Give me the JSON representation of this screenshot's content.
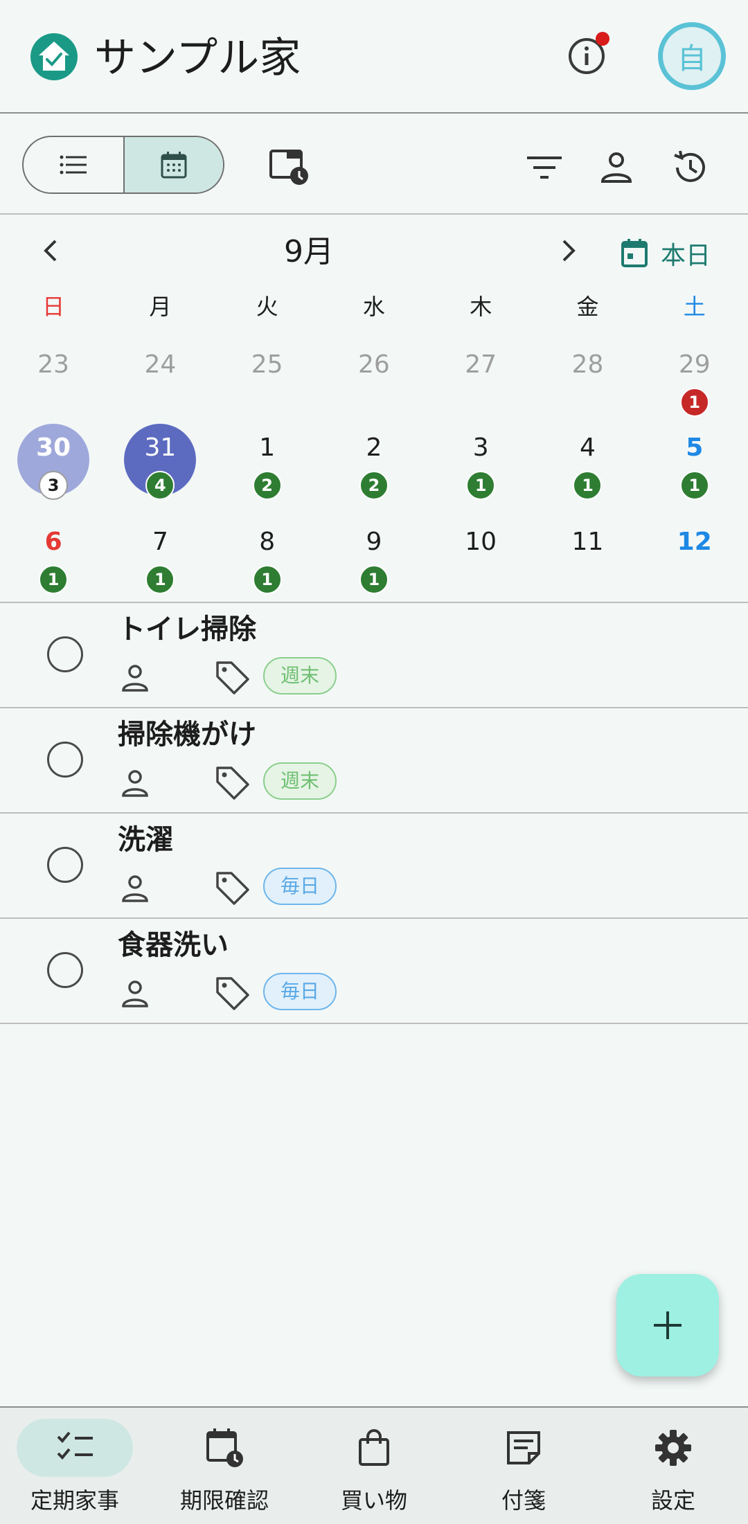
{
  "app": {
    "title": "サンプル家",
    "avatar_label": "自",
    "logo_icon": "home-check-icon"
  },
  "toolbar": {
    "view_list_icon": "list-icon",
    "view_calendar_icon": "calendar-icon",
    "schedule_icon": "calendar-clock-icon",
    "filter_icon": "filter-icon",
    "person_icon": "person-icon",
    "history_icon": "history-icon"
  },
  "calendar": {
    "month_label": "9月",
    "today_label": "本日",
    "weekdays": [
      "日",
      "月",
      "火",
      "水",
      "木",
      "金",
      "土"
    ],
    "weeks": [
      [
        {
          "day": "23",
          "count": ""
        },
        {
          "day": "24",
          "count": ""
        },
        {
          "day": "25",
          "count": ""
        },
        {
          "day": "26",
          "count": ""
        },
        {
          "day": "27",
          "count": ""
        },
        {
          "day": "28",
          "count": ""
        },
        {
          "day": "29",
          "count": "1"
        }
      ],
      [
        {
          "day": "30",
          "count": "3"
        },
        {
          "day": "31",
          "count": "4"
        },
        {
          "day": "1",
          "count": "2"
        },
        {
          "day": "2",
          "count": "2"
        },
        {
          "day": "3",
          "count": "1"
        },
        {
          "day": "4",
          "count": "1"
        },
        {
          "day": "5",
          "count": "1"
        }
      ],
      [
        {
          "day": "6",
          "count": "1"
        },
        {
          "day": "7",
          "count": "1"
        },
        {
          "day": "8",
          "count": "1"
        },
        {
          "day": "9",
          "count": "1"
        },
        {
          "day": "10",
          "count": ""
        },
        {
          "day": "11",
          "count": ""
        },
        {
          "day": "12",
          "count": ""
        }
      ]
    ],
    "colors": {
      "sunday": "#e53935",
      "saturday": "#1e88e5",
      "prev_month": "#9e9e9e",
      "selected": "#9fa8da",
      "today": "#5c6bc0"
    }
  },
  "tasks": [
    {
      "title": "トイレ掃除",
      "chip": "週末",
      "chip_color": "green"
    },
    {
      "title": "掃除機がけ",
      "chip": "週末",
      "chip_color": "green"
    },
    {
      "title": "洗濯",
      "chip": "毎日",
      "chip_color": "blue"
    },
    {
      "title": "食器洗い",
      "chip": "毎日",
      "chip_color": "blue"
    }
  ],
  "fab": {
    "icon": "plus-icon"
  },
  "nav": [
    {
      "label": "定期家事",
      "icon": "checklist-icon",
      "active": true
    },
    {
      "label": "期限確認",
      "icon": "calendar-clock-icon",
      "active": false
    },
    {
      "label": "買い物",
      "icon": "shopping-bag-icon",
      "active": false
    },
    {
      "label": "付箋",
      "icon": "sticky-note-icon",
      "active": false
    },
    {
      "label": "設定",
      "icon": "gear-icon",
      "active": false
    }
  ]
}
